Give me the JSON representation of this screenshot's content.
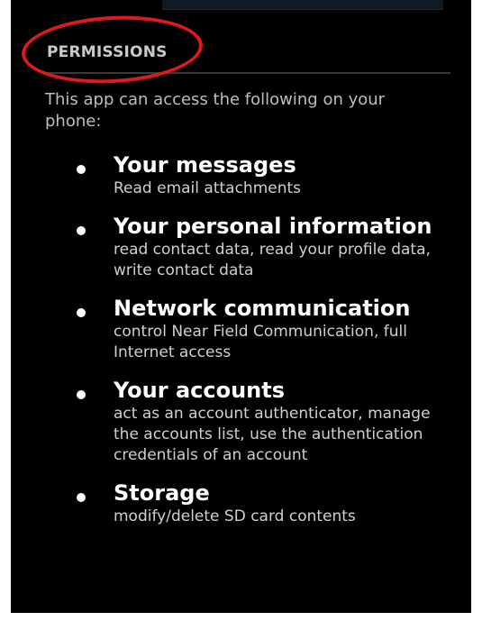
{
  "header": {
    "title": "PERMISSIONS"
  },
  "intro": "This app can access the following on your phone:",
  "permissions": [
    {
      "title": "Your messages",
      "description": "Read email attachments"
    },
    {
      "title": "Your personal information",
      "description": "read contact data, read your profile data, write contact data"
    },
    {
      "title": "Network communication",
      "description": "control Near Field Communication, full Internet access"
    },
    {
      "title": "Your accounts",
      "description": "act as an account authenticator, manage the accounts list, use the authentication credentials of an account"
    },
    {
      "title": "Storage",
      "description": "modify/delete SD card contents"
    }
  ],
  "colors": {
    "background": "#000000",
    "highlight": "#e01a1a",
    "header_text": "#c9c9c9",
    "title_text": "#ffffff",
    "body_text": "#cfcfcf"
  }
}
